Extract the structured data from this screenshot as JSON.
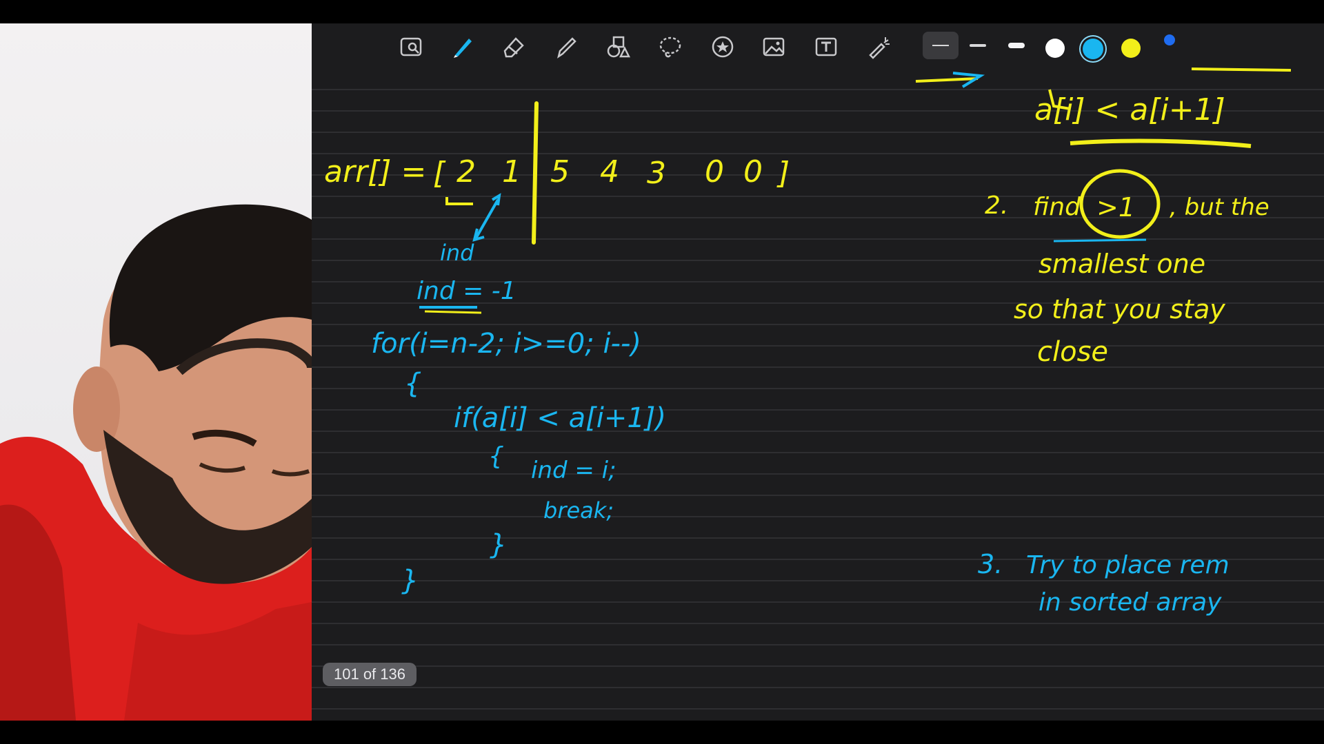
{
  "colors": {
    "ink_yellow": "#f2ef1a",
    "ink_blue": "#1ab6f0",
    "canvas": "#1c1c1e",
    "toolbar_icon": "#c9c9cc",
    "skin": "#d49678",
    "hoodie": "#dc1f1d",
    "hair": "#1a1513"
  },
  "toolbar": {
    "tools": [
      {
        "name": "scan-text-icon"
      },
      {
        "name": "pen-icon"
      },
      {
        "name": "eraser-icon"
      },
      {
        "name": "highlighter-icon"
      },
      {
        "name": "shapes-icon"
      },
      {
        "name": "lasso-icon"
      },
      {
        "name": "sticker-icon"
      },
      {
        "name": "image-icon"
      },
      {
        "name": "text-box-icon"
      },
      {
        "name": "laser-pointer-icon"
      }
    ],
    "stroke_widths": [
      "thin",
      "medium",
      "thick"
    ],
    "swatches": [
      "#ffffff",
      "#1ab6f0",
      "#f2ef1a",
      "#1f6cf0"
    ],
    "selected_swatch": "#1ab6f0"
  },
  "notes": {
    "array_line": {
      "label": "arr[] =",
      "open_bracket": "[",
      "values": [
        "2",
        "1",
        "5",
        "4",
        "3",
        "0",
        "0"
      ],
      "close_bracket": "]"
    },
    "index_label": "ind",
    "ind_init": "ind = -1",
    "code": {
      "for_line": "for(i=n-2; i>=0; i--)",
      "open_brace": "{",
      "if_line": "if(a[i] < a[i+1])",
      "inner_open": "{",
      "assign": "ind = i;",
      "break_stmt": "break;",
      "inner_close": "}",
      "close_brace": "}"
    },
    "right": {
      "condition": "a[i] < a[i+1]",
      "step2_num": "2.",
      "step2_a": "find",
      "step2_circle": ">1",
      "step2_b": ", but the",
      "step2_line2": "smallest one",
      "step2_line3": "so that you stay",
      "step2_line4": "close",
      "step3_num": "3.",
      "step3_line1": "Try to place rem",
      "step3_line2": "in sorted array"
    }
  },
  "page_indicator": "101 of 136"
}
